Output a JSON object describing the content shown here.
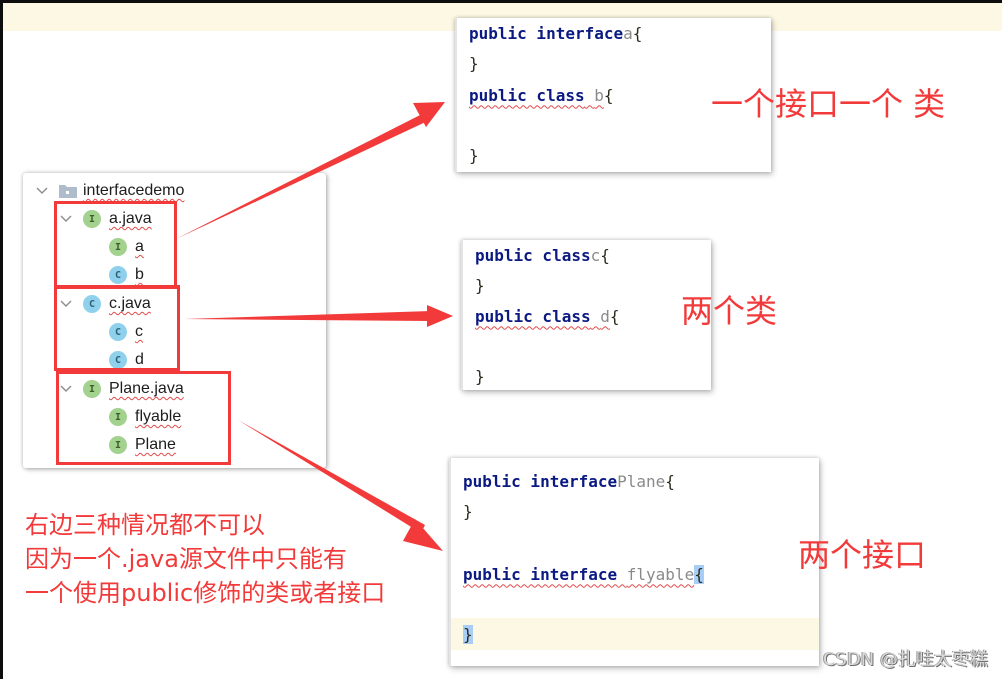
{
  "tree": {
    "root": {
      "label": "interfacedemo",
      "icon": "folder-icon"
    },
    "files": [
      {
        "label": "a.java",
        "kind": "interface",
        "children": [
          {
            "label": "a",
            "kind": "interface"
          },
          {
            "label": "b",
            "kind": "class"
          }
        ]
      },
      {
        "label": "c.java",
        "kind": "class",
        "children": [
          {
            "label": "c",
            "kind": "class"
          },
          {
            "label": "d",
            "kind": "class"
          }
        ]
      },
      {
        "label": "Plane.java",
        "kind": "interface",
        "children": [
          {
            "label": "flyable",
            "kind": "interface"
          },
          {
            "label": "Plane",
            "kind": "interface"
          }
        ]
      }
    ],
    "badge_letters": {
      "interface": "I",
      "class": "C"
    }
  },
  "code_panels": [
    {
      "lines": [
        {
          "kw": "public interface",
          "name": "a",
          "brace": "{"
        },
        {
          "brace_only": "}"
        },
        {
          "kw": "public class",
          "name": "b",
          "brace": "{",
          "error": true
        },
        {
          "blank": true
        },
        {
          "brace_only": "}"
        }
      ],
      "caption": "一个接口一个 类"
    },
    {
      "lines": [
        {
          "kw": "public class",
          "name": "c",
          "brace": "{"
        },
        {
          "brace_only": "}"
        },
        {
          "kw": "public class",
          "name": "d",
          "brace": "{",
          "error": true
        },
        {
          "blank": true
        },
        {
          "brace_only": "}"
        }
      ],
      "caption": "两个类"
    },
    {
      "lines": [
        {
          "kw": "public interface",
          "name": "Plane",
          "brace": "{"
        },
        {
          "brace_only": "}"
        },
        {
          "blank": true
        },
        {
          "kw": "public interface",
          "name": "flyable",
          "brace": "{",
          "error": true
        },
        {
          "blank": true
        },
        {
          "brace_only": "}"
        }
      ],
      "caption": "两个接口"
    }
  ],
  "note": {
    "lines": [
      "右边三种情况都不可以",
      "因为一个.java源文件中只能有",
      "一个使用public修饰的类或者接口"
    ]
  },
  "watermark": "CSDN @扎哇太枣糕",
  "colors": {
    "annotation_red": "#f23a3a",
    "keyword_blue": "#0b1a82",
    "identifier_gray": "#8a8a8a",
    "interface_badge": "#a3d28e",
    "class_badge": "#8fd1ec",
    "caret_line": "#fdf8e4",
    "brace_match": "#a8cdf6"
  }
}
